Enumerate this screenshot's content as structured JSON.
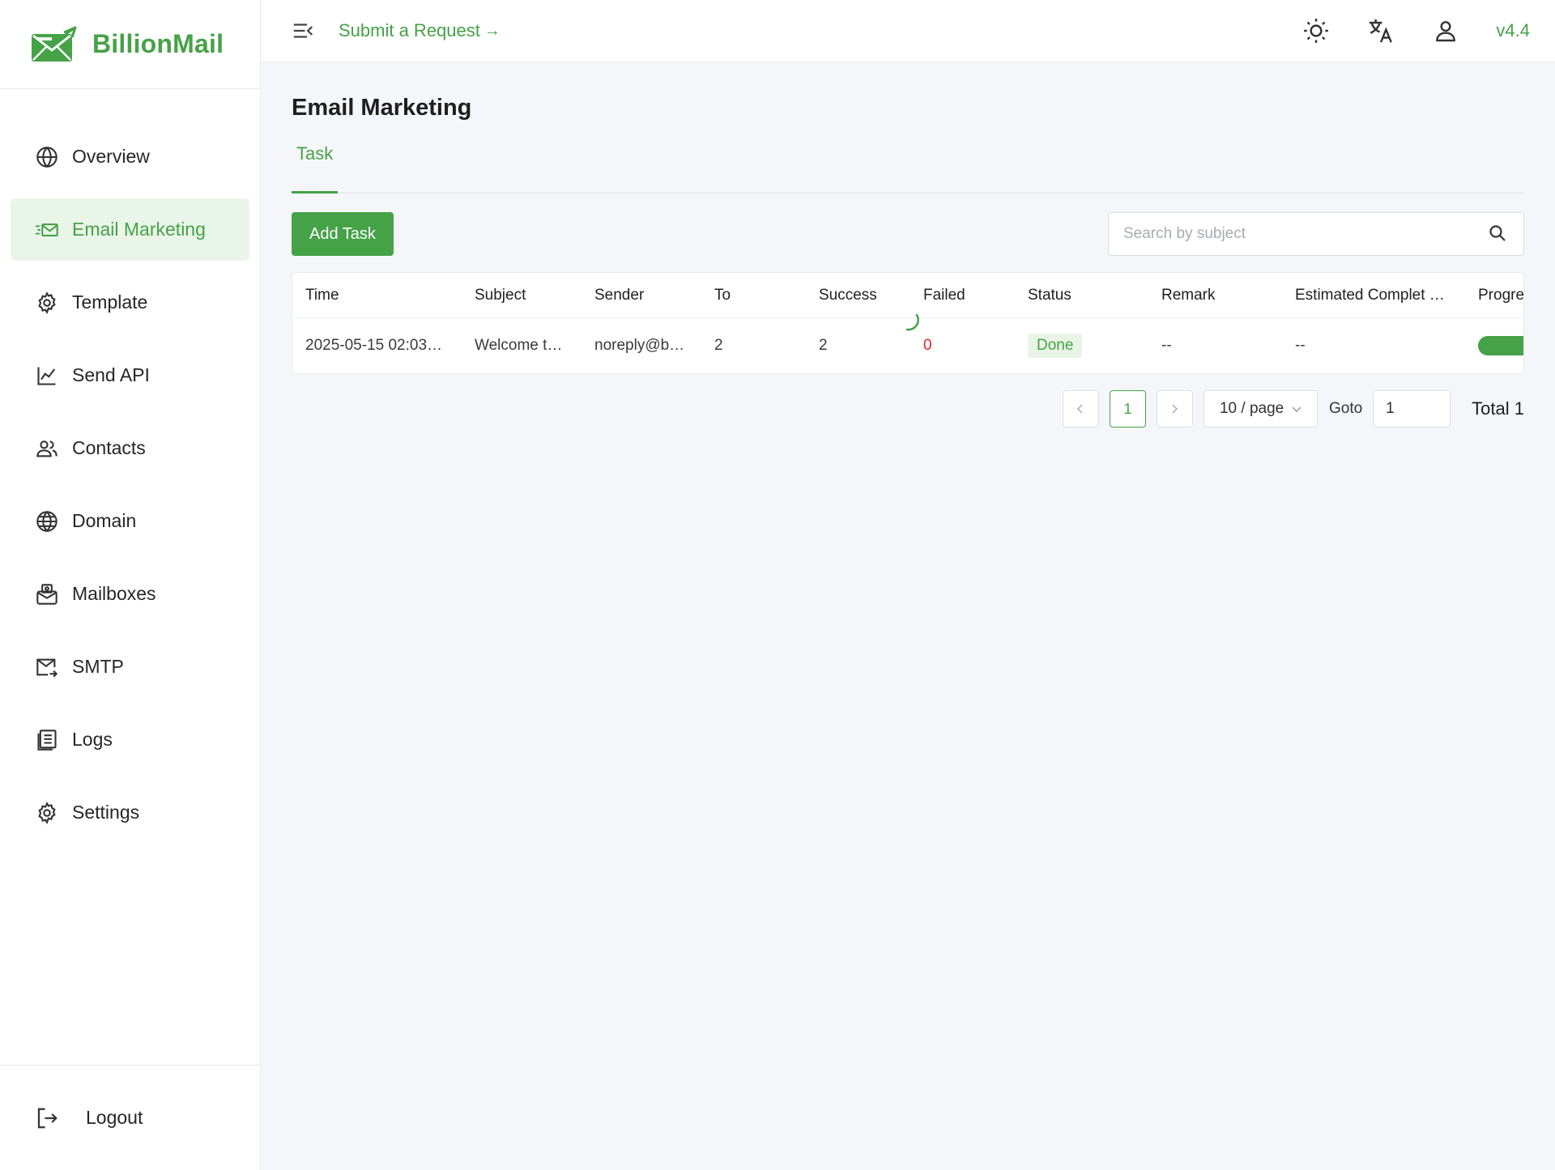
{
  "brand": {
    "name": "BillionMail"
  },
  "sidebar": {
    "items": [
      {
        "label": "Overview",
        "icon": "globe-icon"
      },
      {
        "label": "Email Marketing",
        "icon": "email-send-icon",
        "active": true
      },
      {
        "label": "Template",
        "icon": "gear-icon"
      },
      {
        "label": "Send API",
        "icon": "line-chart-icon"
      },
      {
        "label": "Contacts",
        "icon": "users-icon"
      },
      {
        "label": "Domain",
        "icon": "globe-icon"
      },
      {
        "label": "Mailboxes",
        "icon": "mailbox-icon"
      },
      {
        "label": "SMTP",
        "icon": "mail-forward-icon"
      },
      {
        "label": "Logs",
        "icon": "document-icon"
      },
      {
        "label": "Settings",
        "icon": "gear-icon"
      }
    ],
    "logout_label": "Logout"
  },
  "header": {
    "submit_request": "Submit a Request",
    "arrow": "→",
    "version": "v4.4"
  },
  "main": {
    "title": "Email Marketing",
    "tabs": [
      {
        "label": "Task",
        "active": true
      }
    ],
    "add_button": "Add Task",
    "search": {
      "placeholder": "Search by subject",
      "value": ""
    },
    "table": {
      "columns": [
        "Time",
        "Subject",
        "Sender",
        "To",
        "Success",
        "Failed",
        "Status",
        "Remark",
        "Estimated Complet …",
        "Progre"
      ],
      "rows": [
        {
          "time": "2025-05-15 02:03…",
          "subject": "Welcome t…",
          "sender": "noreply@b…",
          "to": "2",
          "success": "2",
          "failed": "0",
          "status": "Done",
          "remark": "--",
          "estimated": "--",
          "progress": 1.0
        }
      ]
    },
    "pagination": {
      "current_page": "1",
      "page_size": "10 / page",
      "goto_label": "Goto",
      "goto_value": "1",
      "total": "Total 1"
    }
  },
  "colors": {
    "accent": "#45a247",
    "failed": "#e02424",
    "active_bg": "#eaf5e9"
  }
}
